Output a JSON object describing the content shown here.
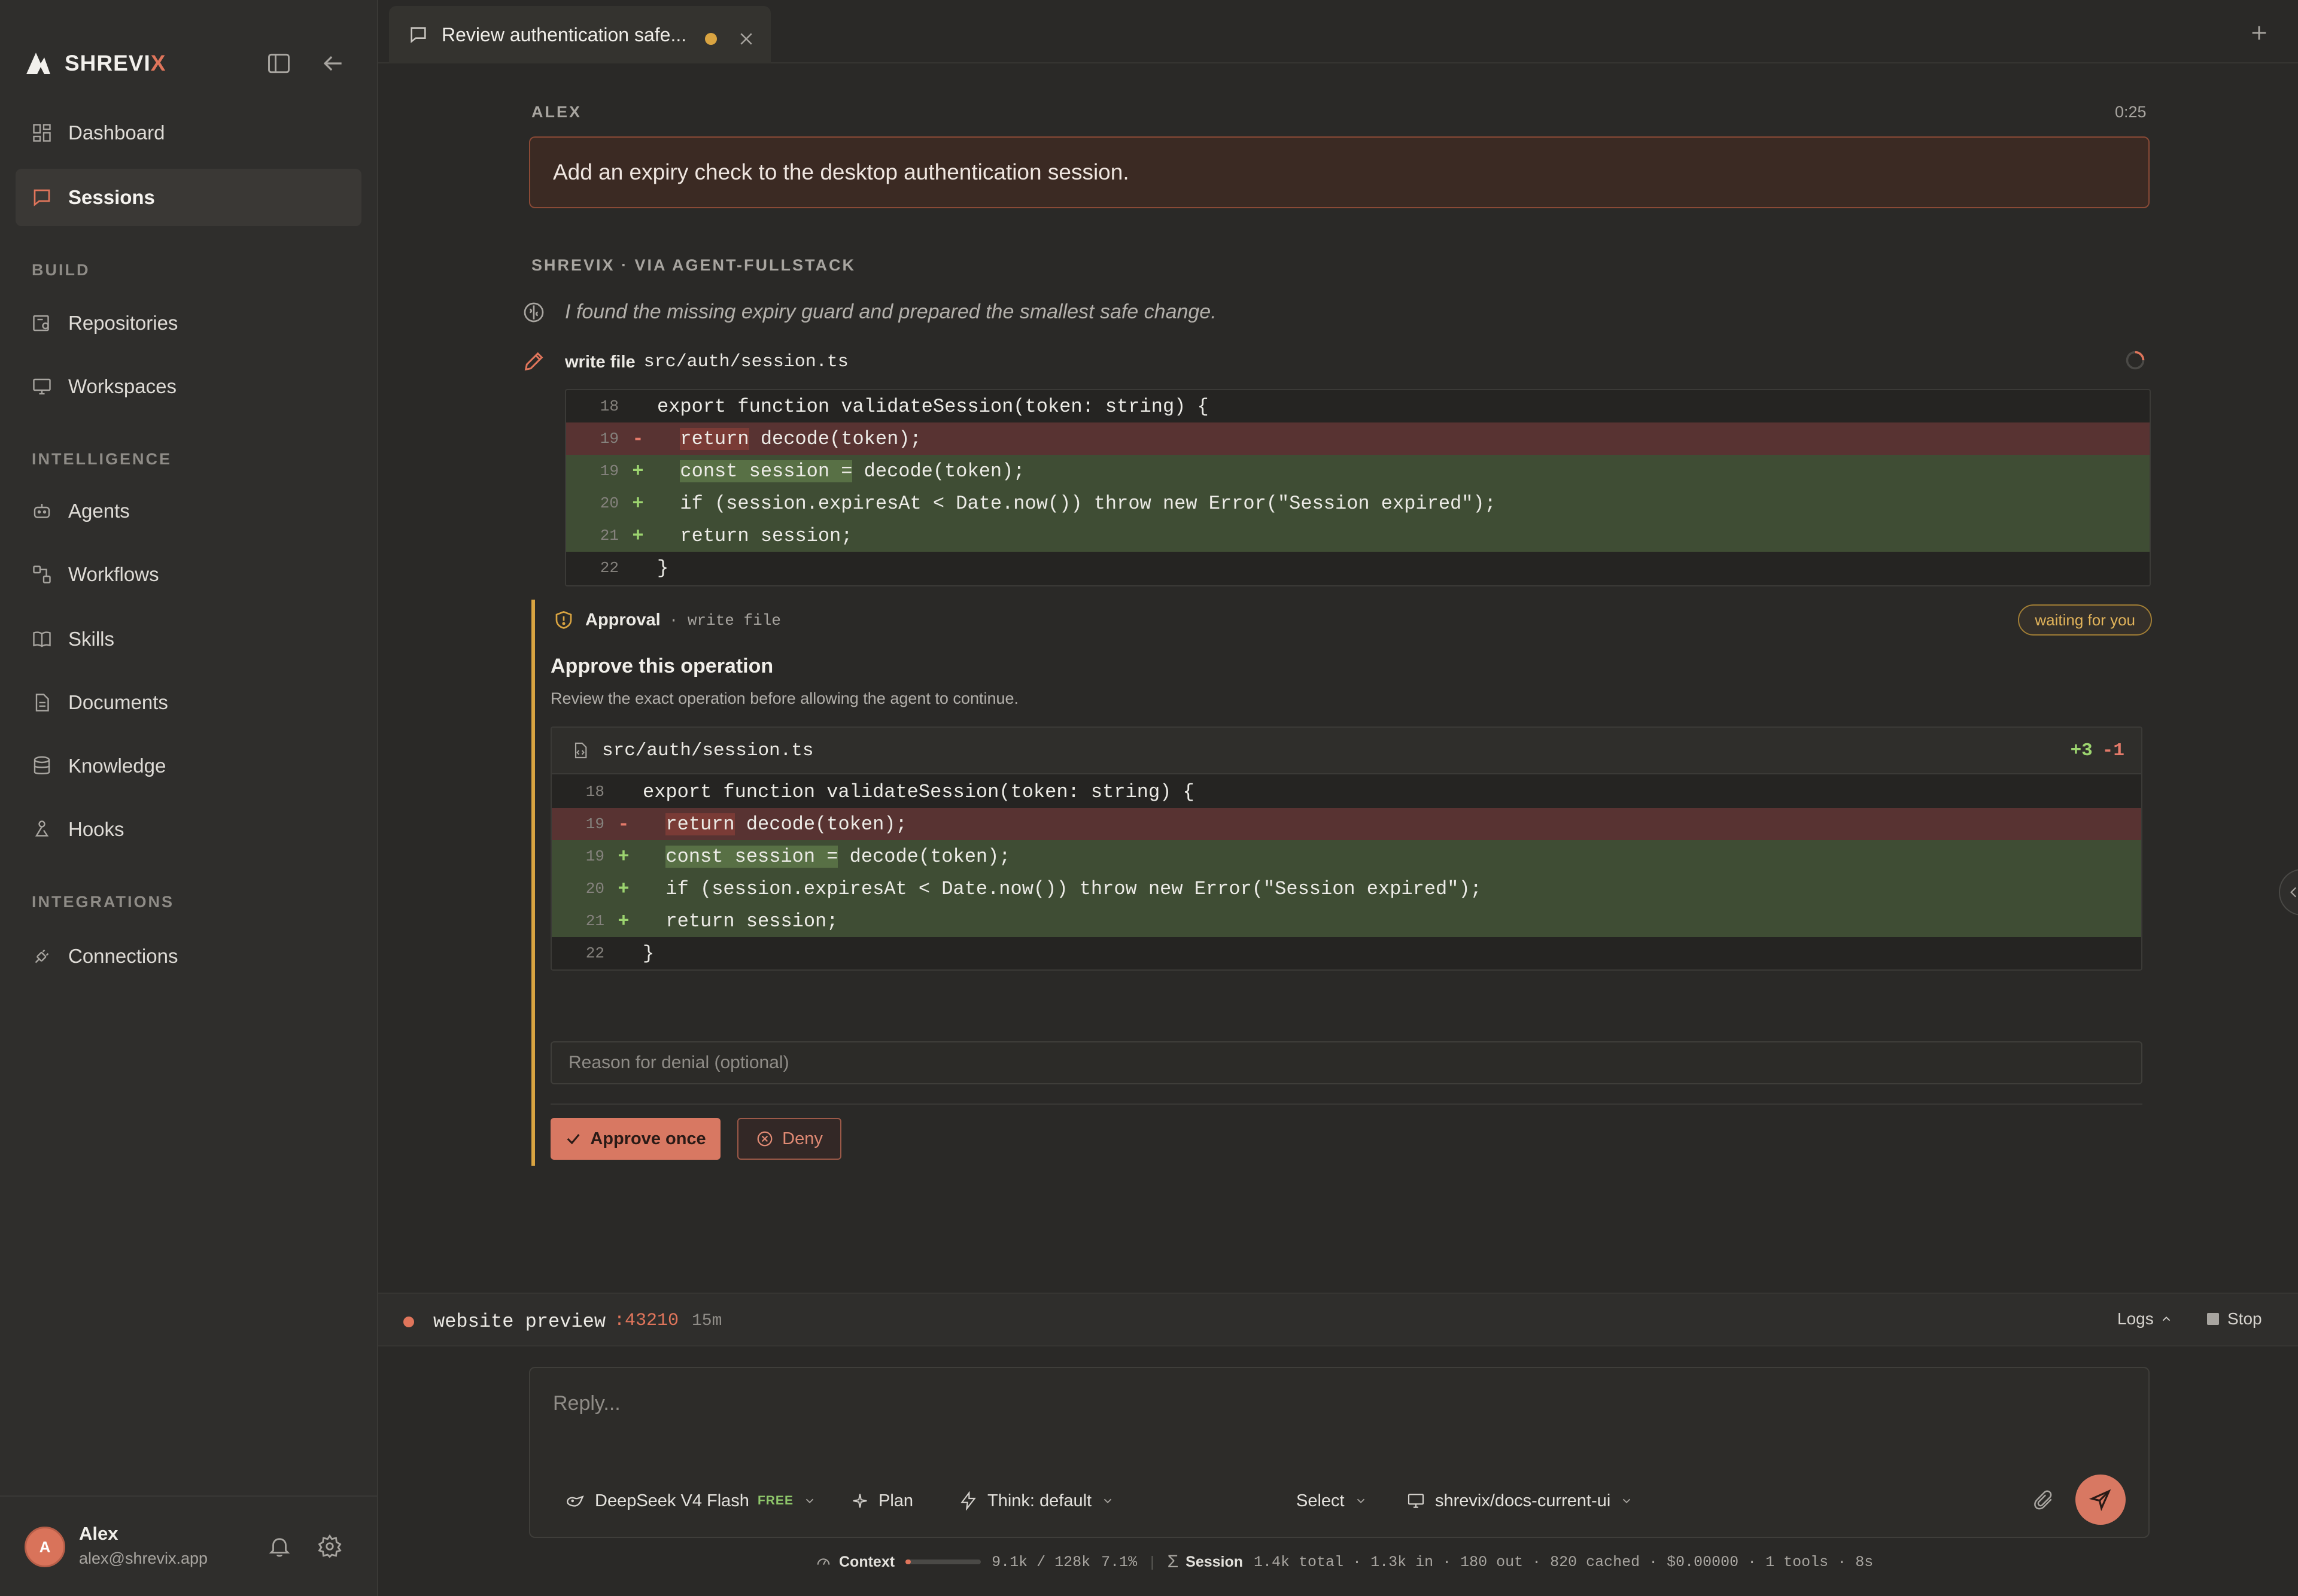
{
  "brand": {
    "name_main": "SHREVI",
    "name_accent": "X"
  },
  "sidebar": {
    "items": [
      {
        "label": "Dashboard",
        "icon": "dashboard-icon"
      },
      {
        "label": "Sessions",
        "icon": "chat-icon",
        "active": true
      }
    ],
    "sections": [
      {
        "title": "BUILD",
        "items": [
          {
            "label": "Repositories",
            "icon": "repo-icon"
          },
          {
            "label": "Workspaces",
            "icon": "monitor-icon"
          }
        ]
      },
      {
        "title": "INTELLIGENCE",
        "items": [
          {
            "label": "Agents",
            "icon": "robot-icon"
          },
          {
            "label": "Workflows",
            "icon": "workflow-icon"
          },
          {
            "label": "Skills",
            "icon": "book-icon"
          },
          {
            "label": "Documents",
            "icon": "document-icon"
          },
          {
            "label": "Knowledge",
            "icon": "database-icon"
          },
          {
            "label": "Hooks",
            "icon": "hook-icon"
          }
        ]
      },
      {
        "title": "INTEGRATIONS",
        "items": [
          {
            "label": "Connections",
            "icon": "plug-icon"
          }
        ]
      }
    ],
    "user": {
      "initial": "A",
      "name": "Alex",
      "email": "alex@shrevix.app"
    }
  },
  "tab": {
    "title": "Review authentication safe..."
  },
  "conversation": {
    "user_speaker": "ALEX",
    "user_time": "0:25",
    "user_message": "Add an expiry check to the desktop authentication session.",
    "agent_speaker": "SHREVIX · VIA AGENT-FULLSTACK",
    "thought": "I found the missing expiry guard and prepared the smallest safe change.",
    "tool_label": "write file",
    "tool_path": "src/auth/session.ts"
  },
  "diff": {
    "lines": [
      {
        "ln": "18",
        "sign": "",
        "type": "ctx",
        "pre": "export function validateSession(token: string) {",
        "hl": "",
        "post": ""
      },
      {
        "ln": "19",
        "sign": "-",
        "type": "del",
        "pre": "  ",
        "hl": "return",
        "post": " decode(token);"
      },
      {
        "ln": "19",
        "sign": "+",
        "type": "add",
        "pre": "  ",
        "hl": "const session =",
        "post": " decode(token);"
      },
      {
        "ln": "20",
        "sign": "+",
        "type": "add",
        "pre": "  if (session.expiresAt < Date.now()) throw new Error(\"Session expired\");",
        "hl": "",
        "post": ""
      },
      {
        "ln": "21",
        "sign": "+",
        "type": "add",
        "pre": "  return session;",
        "hl": "",
        "post": ""
      },
      {
        "ln": "22",
        "sign": "",
        "type": "ctx",
        "pre": "}",
        "hl": "",
        "post": ""
      }
    ]
  },
  "approval": {
    "title": "Approval",
    "op": "· write file",
    "status": "waiting for you",
    "heading": "Approve this operation",
    "description": "Review the exact operation before allowing the agent to continue.",
    "file": "src/auth/session.ts",
    "added": "+3",
    "removed": "-1",
    "reason_placeholder": "Reason for denial (optional)",
    "approve_label": "Approve once",
    "deny_label": "Deny"
  },
  "preview": {
    "name": "website preview",
    "port": ":43210",
    "age": "15m",
    "logs_label": "Logs",
    "stop_label": "Stop"
  },
  "composer": {
    "placeholder": "Reply...",
    "model": "DeepSeek V4 Flash",
    "model_badge": "FREE",
    "plan": "Plan",
    "think": "Think: default",
    "select": "Select",
    "workspace": "shrevix/docs-current-ui"
  },
  "status": {
    "context_label": "Context",
    "context_value": "9.1k / 128k",
    "context_pct": "7.1%",
    "context_fraction": 0.071,
    "session_label": "Session",
    "session_stats": "1.4k total · 1.3k in · 180 out · 820 cached · $0.00000 · 1 tools · 8s"
  },
  "colors": {
    "accent": "#e0755b",
    "warning": "#d9a441",
    "added": "#9cd46f",
    "removed": "#e47a6a"
  }
}
